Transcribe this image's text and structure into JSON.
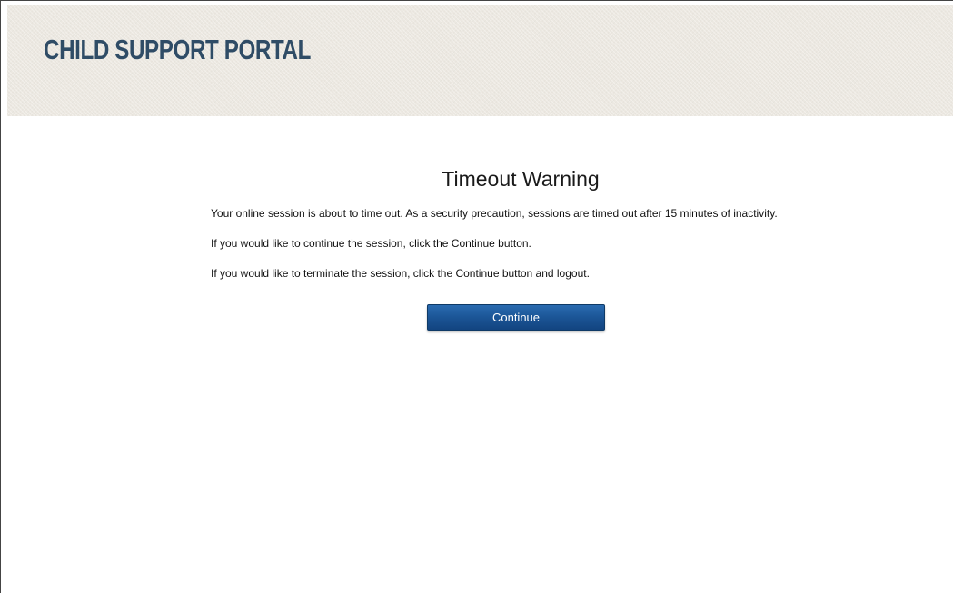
{
  "header": {
    "title": "CHILD SUPPORT PORTAL"
  },
  "dialog": {
    "heading": "Timeout Warning",
    "messages": [
      "Your online session is about to time out. As a security precaution, sessions are timed out after 15 minutes of inactivity.",
      "If you would like to continue the session, click the Continue button.",
      "If you would like to terminate the session, click the Continue button and logout."
    ],
    "continue_label": "Continue"
  },
  "colors": {
    "brand_title": "#2f4c66",
    "header_bg": "#ece8e1",
    "button_bg": "#1b5596"
  }
}
